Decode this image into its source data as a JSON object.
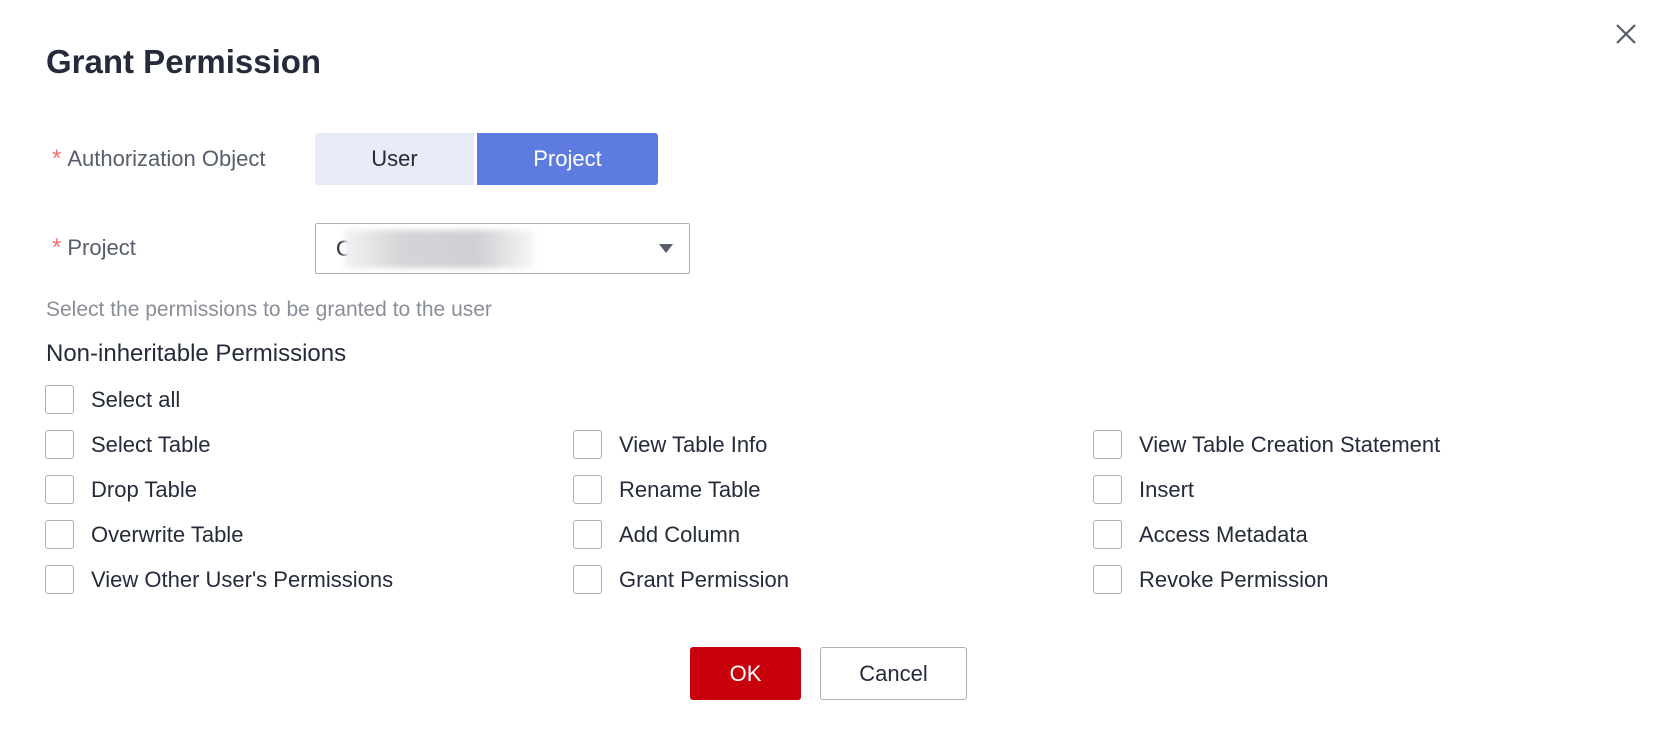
{
  "dialog": {
    "title": "Grant Permission",
    "close_icon": "close-icon"
  },
  "form": {
    "authorization_object": {
      "label": "Authorization Object",
      "required_mark": "*",
      "options": [
        "User",
        "Project"
      ],
      "selected": "Project"
    },
    "project": {
      "label": "Project",
      "required_mark": "*",
      "value_visible_prefix": "C",
      "value_redacted": true,
      "dropdown_icon": "caret-down-icon"
    }
  },
  "permissions": {
    "hint": "Select the permissions to be granted to the user",
    "section_title": "Non-inheritable Permissions",
    "select_all": {
      "label": "Select all",
      "checked": false
    },
    "items": [
      {
        "label": "Select Table",
        "checked": false
      },
      {
        "label": "View Table Info",
        "checked": false
      },
      {
        "label": "View Table Creation Statement",
        "checked": false
      },
      {
        "label": "Drop Table",
        "checked": false
      },
      {
        "label": "Rename Table",
        "checked": false
      },
      {
        "label": "Insert",
        "checked": false
      },
      {
        "label": "Overwrite Table",
        "checked": false
      },
      {
        "label": "Add Column",
        "checked": false
      },
      {
        "label": "Access Metadata",
        "checked": false
      },
      {
        "label": "View Other User's Permissions",
        "checked": false
      },
      {
        "label": "Grant Permission",
        "checked": false
      },
      {
        "label": "Revoke Permission",
        "checked": false
      }
    ]
  },
  "footer": {
    "ok_label": "OK",
    "cancel_label": "Cancel"
  },
  "colors": {
    "primary_button": "#c7000b",
    "segment_selected": "#5e7ce0",
    "segment_unselected": "#e8ecf8",
    "required_mark": "#f66f6a"
  }
}
